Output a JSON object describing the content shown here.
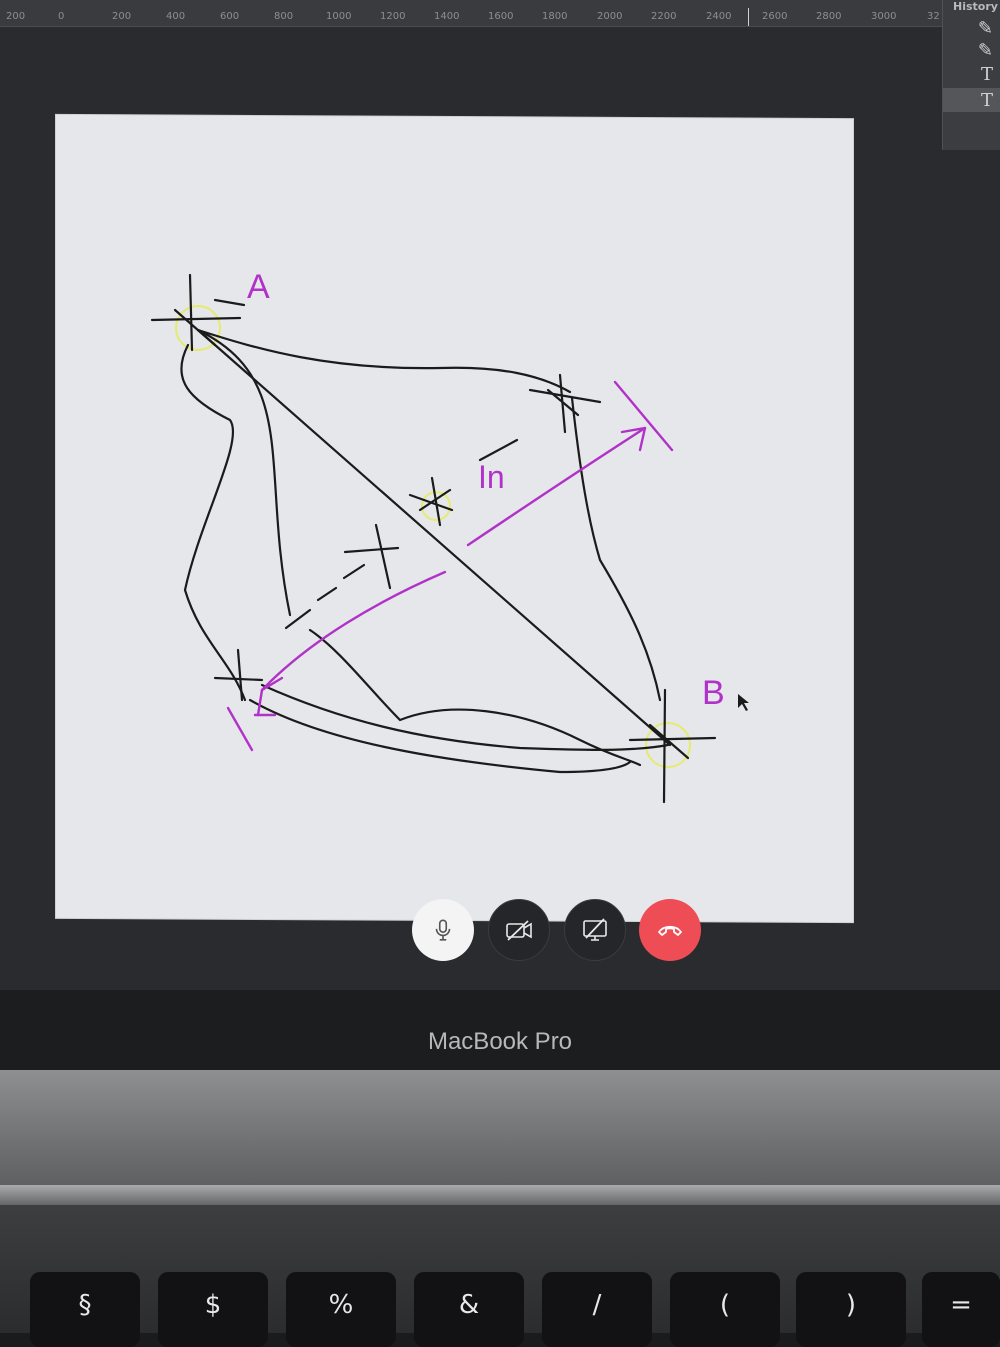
{
  "ruler": {
    "ticks": [
      "200",
      "0",
      "200",
      "400",
      "600",
      "800",
      "1000",
      "1200",
      "1400",
      "1600",
      "1800",
      "2000",
      "2200",
      "2400",
      "2600",
      "2800",
      "3000",
      "32"
    ]
  },
  "history": {
    "title": "History",
    "items": [
      {
        "icon": "brush-icon",
        "glyph": "✎"
      },
      {
        "icon": "brush-icon",
        "glyph": "✎"
      },
      {
        "icon": "type-tool-icon",
        "glyph": "T"
      },
      {
        "icon": "type-tool-icon",
        "glyph": "T"
      }
    ]
  },
  "canvas": {
    "label_a": "A",
    "label_b": "B",
    "label_in": "In"
  },
  "call_controls": [
    {
      "name": "microphone-button",
      "icon": "microphone-icon"
    },
    {
      "name": "camera-off-button",
      "icon": "camera-off-icon"
    },
    {
      "name": "screen-share-off-button",
      "icon": "screen-share-off-icon"
    },
    {
      "name": "end-call-button",
      "icon": "phone-hangup-icon"
    }
  ],
  "colors": {
    "accent_magenta": "#b032c8",
    "end_call_red": "#ee4d55",
    "highlight_yellow": "#e6ea5a"
  },
  "bezel": {
    "label": "MacBook Pro"
  },
  "keys": [
    "§",
    "$",
    "%",
    "&",
    "/",
    "(",
    ")",
    "="
  ]
}
